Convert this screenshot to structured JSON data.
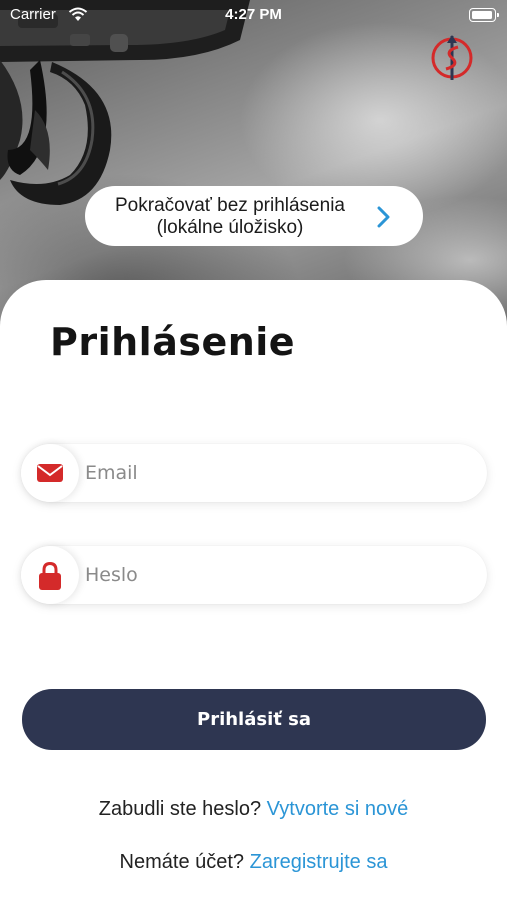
{
  "status_bar": {
    "carrier": "Carrier",
    "time": "4:27 PM"
  },
  "continue_guest": {
    "line1": "Pokračovať bez prihlásenia",
    "line2": "(lokálne úložisko)",
    "icon": "chevron-right-icon"
  },
  "login": {
    "title": "Prihlásenie",
    "email_placeholder": "Email",
    "email_icon": "mail-icon",
    "password_placeholder": "Heslo",
    "password_icon": "lock-icon",
    "submit_label": "Prihlásiť sa"
  },
  "forgot": {
    "text": "Zabudli ste heslo?",
    "link": "Vytvorte si nové"
  },
  "register": {
    "text": "Nemáte účet?",
    "link": "Zaregistrujte sa"
  },
  "colors": {
    "accent_red": "#d42a2a",
    "button_navy": "#2e3651",
    "link_blue": "#2b95d6"
  }
}
